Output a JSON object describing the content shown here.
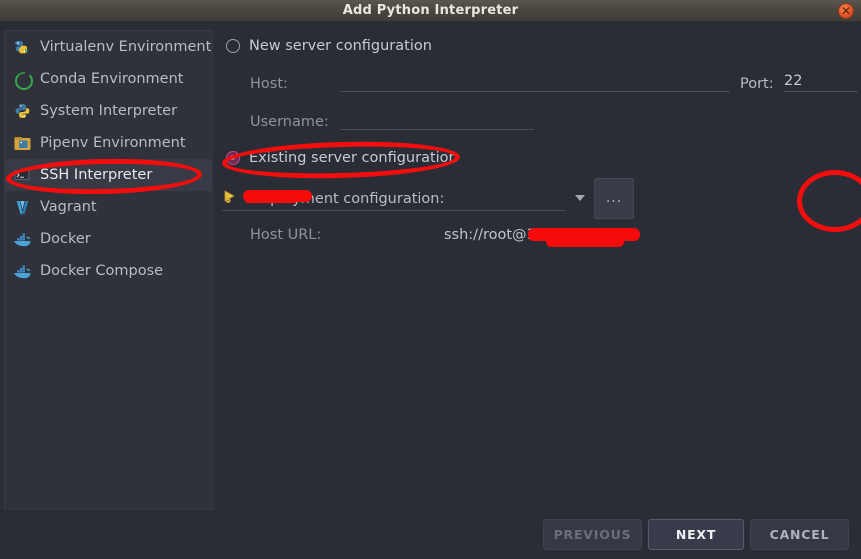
{
  "window": {
    "title": "Add Python Interpreter",
    "close_icon": "close-icon"
  },
  "sidebar": {
    "items": [
      {
        "label": "Virtualenv Environment",
        "icon": "virtualenv-icon",
        "selected": false
      },
      {
        "label": "Conda Environment",
        "icon": "conda-icon",
        "selected": false
      },
      {
        "label": "System Interpreter",
        "icon": "python-icon",
        "selected": false
      },
      {
        "label": "Pipenv Environment",
        "icon": "pipenv-icon",
        "selected": false
      },
      {
        "label": "SSH Interpreter",
        "icon": "ssh-icon",
        "selected": true
      },
      {
        "label": "Vagrant",
        "icon": "vagrant-icon",
        "selected": false
      },
      {
        "label": "Docker",
        "icon": "docker-icon",
        "selected": false
      },
      {
        "label": "Docker Compose",
        "icon": "docker-icon",
        "selected": false
      }
    ]
  },
  "form": {
    "new_server": {
      "radio_label": "New server configuration",
      "checked": false,
      "host_label": "Host:",
      "host_value": "",
      "port_label": "Port:",
      "port_value": "22",
      "username_label": "Username:",
      "username_value": ""
    },
    "existing_server": {
      "radio_label": "Existing server configuration",
      "checked": true,
      "deployment_label": "Deployment configuration:",
      "deployment_value": "",
      "deployment_icon": "server-config-icon",
      "dropdown_icon": "chevron-down-icon",
      "browse_label": "...",
      "host_url_label": "Host URL:",
      "host_url_value": "ssh://root@1                       2"
    }
  },
  "buttons": {
    "previous": "PREVIOUS",
    "next": "NEXT",
    "cancel": "CANCEL"
  },
  "colors": {
    "accent_radio": "#e862ae",
    "annotation_red": "#f40d0d",
    "redaction_red": "#f60b0b",
    "titlebar": "#4b4740",
    "panel_bg": "#2b2d36",
    "sidebar_bg": "#2f313b",
    "selected_row": "#383b46",
    "close_button": "#e2562b"
  }
}
